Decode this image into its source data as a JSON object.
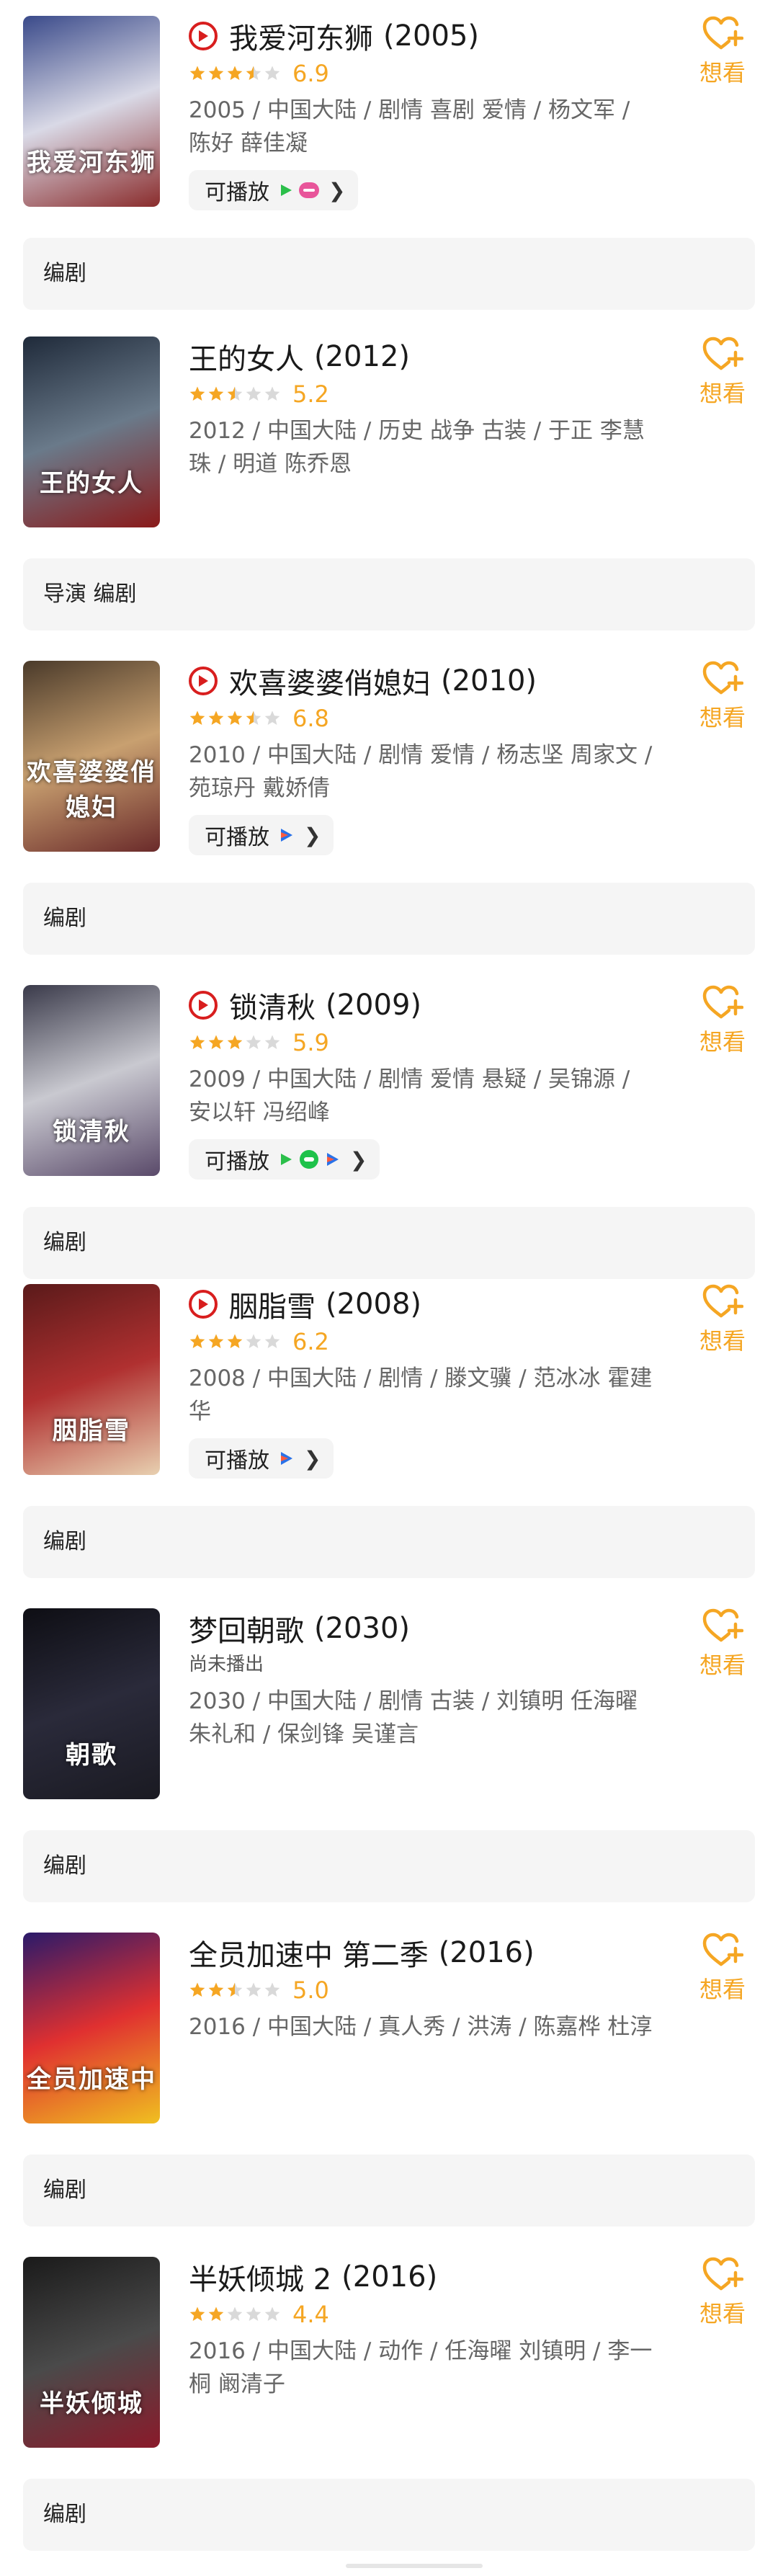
{
  "accent_color": "#f5a623",
  "play_color": "#d81e1e",
  "items": [
    {
      "title": "我爱河东狮",
      "year": "(2005)",
      "has_play": true,
      "rating": 3.5,
      "score": "6.9",
      "meta": "2005 / 中国大陆 / 剧情 喜剧 爱情 / 杨文军 / 陈好 薛佳凝",
      "playable_label": "可播放",
      "sources": [
        "iqiyi",
        "youku"
      ],
      "want_label": "想看",
      "roles": "编剧",
      "poster_text": "我爱河东狮",
      "poster_colors": [
        "#3a4a8a",
        "#d9d9e6",
        "#8a2c2c"
      ]
    },
    {
      "title": "王的女人",
      "year": "(2012)",
      "has_play": false,
      "rating": 2.5,
      "score": "5.2",
      "meta": "2012 / 中国大陆 / 历史 战争 古装 / 于正 李慧珠 / 明道 陈乔恩",
      "playable_label": "",
      "sources": [],
      "want_label": "想看",
      "roles": "导演 编剧",
      "poster_text": "王的女人",
      "poster_colors": [
        "#1f2a3a",
        "#6a7a8a",
        "#8a1a1a"
      ]
    },
    {
      "title": "欢喜婆婆俏媳妇",
      "year": "(2010)",
      "has_play": true,
      "rating": 3.5,
      "score": "6.8",
      "meta": "2010 / 中国大陆 / 剧情 爱情 / 杨志坚 周家文 / 苑琼丹 戴娇倩",
      "playable_label": "可播放",
      "sources": [
        "tencent"
      ],
      "want_label": "想看",
      "roles": "编剧",
      "poster_text": "欢喜婆婆俏媳妇",
      "poster_colors": [
        "#4a3a2a",
        "#c8a070",
        "#6a2a2a"
      ]
    },
    {
      "title": "锁清秋",
      "year": "(2009)",
      "has_play": true,
      "rating": 3,
      "score": "5.9",
      "meta": "2009 / 中国大陆 / 剧情 爱情 悬疑 / 吴锦源 / 安以轩 冯绍峰",
      "playable_label": "可播放",
      "sources": [
        "iqiyi",
        "mgtv",
        "tencent"
      ],
      "want_label": "想看",
      "roles": "编剧",
      "poster_text": "锁清秋",
      "poster_colors": [
        "#3a3a4a",
        "#c9c9d0",
        "#5a4a6a"
      ]
    },
    {
      "title": "胭脂雪",
      "year": "(2008)",
      "has_play": true,
      "rating": 3,
      "score": "6.2",
      "meta": "2008 / 中国大陆 / 剧情 / 滕文骥 / 范冰冰 霍建华",
      "playable_label": "可播放",
      "sources": [
        "tencent"
      ],
      "want_label": "想看",
      "roles": "编剧",
      "poster_text": "胭脂雪",
      "poster_colors": [
        "#5a1a1a",
        "#b03030",
        "#e8d0b0"
      ]
    },
    {
      "title": "梦回朝歌",
      "year": "(2030)",
      "has_play": false,
      "rating": 0,
      "score": "",
      "tba": "尚未播出",
      "meta": "2030 / 中国大陆 / 剧情 古装 / 刘镇明 任海曜 朱礼和 / 保剑锋 吴谨言",
      "playable_label": "",
      "sources": [],
      "want_label": "想看",
      "roles": "编剧",
      "poster_text": "朝歌",
      "poster_colors": [
        "#0e0e14",
        "#2a2a3a",
        "#1a1a22"
      ]
    },
    {
      "title": "全员加速中 第二季",
      "year": "(2016)",
      "has_play": false,
      "rating": 2.5,
      "score": "5.0",
      "meta": "2016 / 中国大陆 / 真人秀 / 洪涛 / 陈嘉桦 杜淳",
      "playable_label": "",
      "sources": [],
      "want_label": "想看",
      "roles": "编剧",
      "poster_text": "全员加速中",
      "poster_colors": [
        "#2a1a6a",
        "#e03030",
        "#f0c020"
      ]
    },
    {
      "title": "半妖倾城 2",
      "year": "(2016)",
      "has_play": false,
      "rating": 2,
      "score": "4.4",
      "meta": "2016 / 中国大陆 / 动作 / 任海曜 刘镇明 / 李一桐 阚清子",
      "playable_label": "",
      "sources": [],
      "want_label": "想看",
      "roles": "编剧",
      "poster_text": "半妖倾城",
      "poster_colors": [
        "#1a1a1a",
        "#4a4a4a",
        "#8a1a2a"
      ]
    }
  ]
}
